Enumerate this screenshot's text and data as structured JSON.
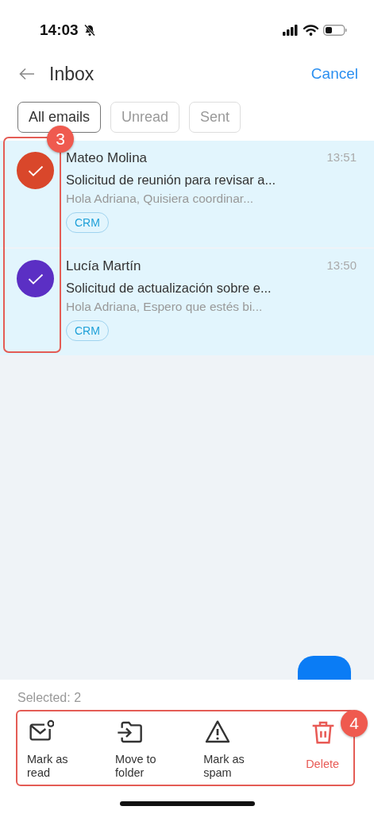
{
  "status_bar": {
    "time": "14:03"
  },
  "header": {
    "title": "Inbox",
    "cancel": "Cancel"
  },
  "tabs": [
    {
      "label": "All emails",
      "selected": true
    },
    {
      "label": "Unread",
      "selected": false
    },
    {
      "label": "Sent",
      "selected": false
    }
  ],
  "messages": [
    {
      "sender": "Mateo Molina",
      "time": "13:51",
      "subject": "Solicitud de reunión para revisar a...",
      "preview": "Hola Adriana, Quisiera coordinar...",
      "tag": "CRM",
      "color": "#d9472b",
      "checked": true,
      "selected": true
    },
    {
      "sender": "Lucía Martín",
      "time": "13:50",
      "subject": "Solicitud de actualización sobre e...",
      "preview": "Hola Adriana, Espero que estés bi...",
      "tag": "CRM",
      "color": "#5b2fc4",
      "checked": true,
      "selected": true
    }
  ],
  "selection": {
    "count_label": "Selected: 2"
  },
  "actions": [
    {
      "kind": "read",
      "label": "Mark as read"
    },
    {
      "kind": "move",
      "label": "Move to folder"
    },
    {
      "kind": "spam",
      "label": "Mark as spam"
    },
    {
      "kind": "delete",
      "label": "Delete"
    }
  ],
  "annotations": [
    {
      "label": "3",
      "kind": "checkboxes"
    },
    {
      "label": "4",
      "kind": "actions"
    }
  ]
}
